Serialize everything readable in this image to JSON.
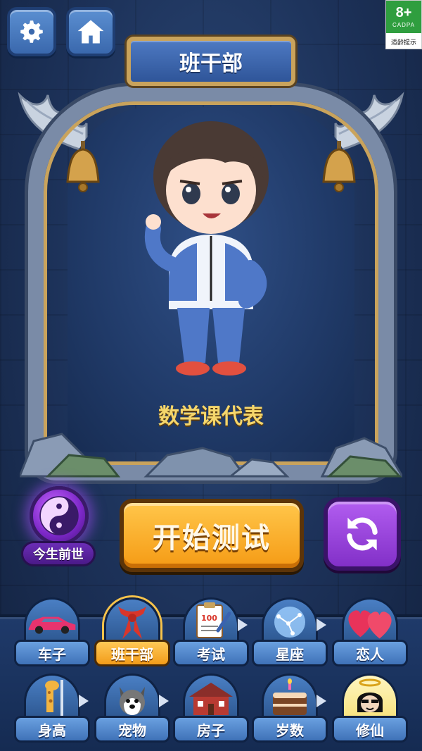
{
  "header": {
    "settings_icon": "gear-icon",
    "home_icon": "home-icon",
    "age_rating": {
      "number": "8+",
      "org": "CADPA",
      "hint": "适龄提示"
    }
  },
  "card": {
    "title": "班干部",
    "role": "数学课代表"
  },
  "actions": {
    "past_life_label": "今生前世",
    "start_label": "开始测试",
    "refresh_icon": "refresh-icon"
  },
  "categories": {
    "row1": [
      {
        "label": "车子",
        "icon": "car-icon"
      },
      {
        "label": "班干部",
        "icon": "red-scarf-icon"
      },
      {
        "label": "考试",
        "icon": "exam-paper-icon"
      },
      {
        "label": "星座",
        "icon": "constellation-icon"
      },
      {
        "label": "恋人",
        "icon": "hearts-icon"
      }
    ],
    "row2": [
      {
        "label": "身高",
        "icon": "giraffe-icon"
      },
      {
        "label": "宠物",
        "icon": "dog-icon"
      },
      {
        "label": "房子",
        "icon": "house-icon"
      },
      {
        "label": "岁数",
        "icon": "cake-icon"
      },
      {
        "label": "修仙",
        "icon": "halo-face-icon"
      }
    ],
    "selected": "班干部"
  },
  "colors": {
    "accent_gold": "#f59b15",
    "accent_purple": "#8230c8",
    "role_text": "#f5d66b"
  }
}
